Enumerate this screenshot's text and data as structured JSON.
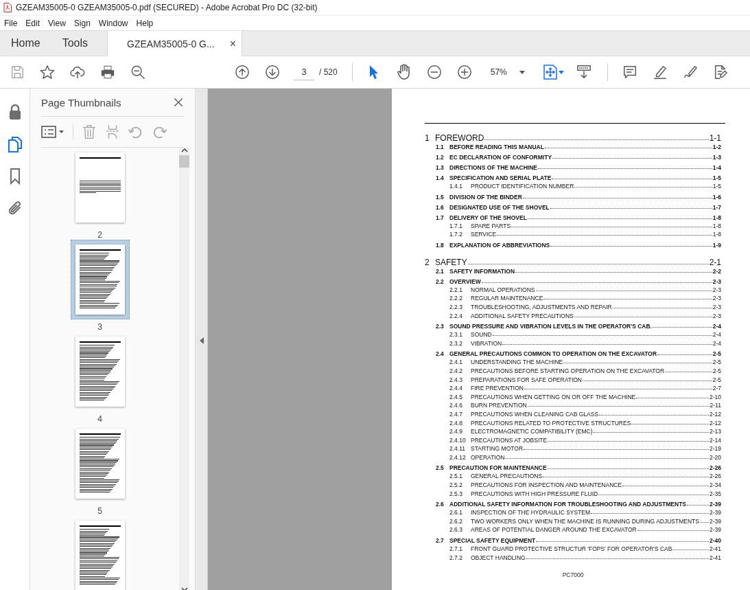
{
  "window": {
    "title": "GZEAM35005-0 GZEAM35005-0.pdf (SECURED) - Adobe Acrobat Pro DC (32-bit)"
  },
  "menu": [
    "File",
    "Edit",
    "View",
    "Sign",
    "Window",
    "Help"
  ],
  "tabs": [
    {
      "label": "Home",
      "selected": false,
      "kind": "nav"
    },
    {
      "label": "Tools",
      "selected": false,
      "kind": "nav"
    },
    {
      "label": "GZEAM35005-0 G...",
      "selected": true,
      "kind": "document",
      "close": "×"
    }
  ],
  "toolbar": {
    "page_field": {
      "value": "3"
    },
    "page_total": "/ 520",
    "zoom": "57%",
    "select_tools": [
      {
        "kind": "pointer",
        "selected": true
      },
      {
        "kind": "hand",
        "selected": false
      }
    ]
  },
  "rail": [
    {
      "kind": "lock",
      "selected": false
    },
    {
      "kind": "pages",
      "selected": true
    },
    {
      "kind": "bookmark",
      "selected": false
    },
    {
      "kind": "attachment",
      "selected": false
    }
  ],
  "sidebar": {
    "title": "Page Thumbnails",
    "thumbnails": [
      {
        "label": "2",
        "selected": false,
        "kind": "sparse"
      },
      {
        "label": "3",
        "selected": true,
        "kind": "toc"
      },
      {
        "label": "4",
        "selected": false,
        "kind": "toc"
      },
      {
        "label": "5",
        "selected": false,
        "kind": "toc"
      },
      {
        "selected": false,
        "kind": "toc"
      }
    ]
  },
  "document": {
    "footer": "PC7000",
    "chapters": [
      {
        "number": "1",
        "title": "FOREWORD",
        "page": "1-1",
        "sections": [
          {
            "number": "1.1",
            "title": "BEFORE READING THIS MANUAL",
            "page": "1-2"
          },
          {
            "number": "1.2",
            "title": "EC DECLARATION OF CONFORMITY",
            "page": "1-3"
          },
          {
            "number": "1.3",
            "title": "DIRECTIONS OF THE MACHINE",
            "page": "1-4"
          },
          {
            "number": "1.4",
            "title": "SPECIFICATION AND SERIAL PLATE",
            "page": "1-5",
            "children": [
              {
                "number": "1.4.1",
                "title": "PRODUCT IDENTIFICATION NUMBER",
                "page": "1-5"
              }
            ]
          },
          {
            "number": "1.5",
            "title": "DIVISION OF THE BINDER",
            "page": "1-6"
          },
          {
            "number": "1.6",
            "title": "DESIGNATED USE OF THE SHOVEL",
            "page": "1-7"
          },
          {
            "number": "1.7",
            "title": "DELIVERY OF THE SHOVEL",
            "page": "1-8",
            "children": [
              {
                "number": "1.7.1",
                "title": "SPARE PARTS",
                "page": "1-8"
              },
              {
                "number": "1.7.2",
                "title": "SERVICE",
                "page": "1-8"
              }
            ]
          },
          {
            "number": "1.8",
            "title": "EXPLANATION OF ABBREVIATIONS",
            "page": "1-9"
          }
        ]
      },
      {
        "number": "2",
        "title": "SAFETY",
        "page": "2-1",
        "sections": [
          {
            "number": "2.1",
            "title": "SAFETY INFORMATION",
            "page": "2-2"
          },
          {
            "number": "2.2",
            "title": "OVERVIEW",
            "page": "2-3",
            "children": [
              {
                "number": "2.2.1",
                "title": "NORMAL OPERATIONS",
                "page": "2-3"
              },
              {
                "number": "2.2.2",
                "title": "REGULAR MAINTENANCE",
                "page": "2-3"
              },
              {
                "number": "2.2.3",
                "title": "TROUBLESHOOTING, ADJUSTMENTS AND REPAIR",
                "page": "2-3"
              },
              {
                "number": "2.2.4",
                "title": "ADDITIONAL SAFETY PRECAUTIONS",
                "page": "2-3"
              }
            ]
          },
          {
            "number": "2.3",
            "title": "SOUND PRESSURE AND VIBRATION LEVELS IN THE OPERATOR'S CAB.",
            "page": "2-4",
            "children": [
              {
                "number": "2.3.1",
                "title": "SOUND",
                "page": "2-4"
              },
              {
                "number": "2.3.2",
                "title": "VIBRATION",
                "page": "2-4"
              }
            ]
          },
          {
            "number": "2.4",
            "title": "GENERAL PRECAUTIONS COMMON TO OPERATION ON THE EXCAVATOR",
            "page": "2-5",
            "children": [
              {
                "number": "2.4.1",
                "title": "UNDERSTANDING THE MACHINE",
                "page": "2-5"
              },
              {
                "number": "2.4.2",
                "title": "PRECAUTIONS BEFORE STARTING OPERATION ON THE EXCAVATOR",
                "page": "2-5"
              },
              {
                "number": "2.4.3",
                "title": "PREPARATIONS FOR SAFE OPERATION",
                "page": "2-5"
              },
              {
                "number": "2.4.4",
                "title": "FIRE PREVENTION",
                "page": "2-7"
              },
              {
                "number": "2.4.5",
                "title": "PRECAUTIONS WHEN GETTING ON OR OFF THE MACHINE",
                "page": "2-10"
              },
              {
                "number": "2.4.6",
                "title": "BURN PREVENTION",
                "page": "2-11"
              },
              {
                "number": "2.4.7",
                "title": "PRECAUTIONS WHEN CLEANING CAB GLASS",
                "page": "2-12"
              },
              {
                "number": "2.4.8",
                "title": "PRECAUTIONS RELATED TO PROTECTIVE STRUCTURES",
                "page": "2-12"
              },
              {
                "number": "2.4.9",
                "title": "ELECTROMAGNETIC COMPATIBILITY (EMC)",
                "page": "2-13"
              },
              {
                "number": "2.4.10",
                "title": "PRECAUTIONS AT JOBSITE",
                "page": "2-14"
              },
              {
                "number": "2.4.11",
                "title": "STARTING MOTOR",
                "page": "2-19"
              },
              {
                "number": "2.4.12",
                "title": "OPERATION",
                "page": "2-20"
              }
            ]
          },
          {
            "number": "2.5",
            "title": "PRECAUTION FOR MAINTENANCE",
            "page": "2-26",
            "children": [
              {
                "number": "2.5.1",
                "title": "GENERAL PRECAUTIONS",
                "page": "2-26"
              },
              {
                "number": "2.5.2",
                "title": "PRECAUTIONS FOR INSPECTION AND MAINTENANCE",
                "page": "2-34"
              },
              {
                "number": "2.5.3",
                "title": "PRECAUTIONS WITH HIGH PRESSURE FLUID",
                "page": "2-35"
              }
            ]
          },
          {
            "number": "2.6",
            "title": "ADDITIONAL SAFETY INFORMATION FOR TROUBLESHOOTING AND ADJUSTMENTS",
            "page": "2-39",
            "children": [
              {
                "number": "2.6.1",
                "title": "INSPECTION OF THE HYDRAULIC SYSTEM",
                "page": "2-39"
              },
              {
                "number": "2.6.2",
                "title": "TWO WORKERS ONLY WHEN THE MACHINE IS RUNNING DURING ADJUSTMENTS",
                "page": "2-39"
              },
              {
                "number": "2.6.3",
                "title": "AREAS OF POTENTIAL DANGER AROUND THE EXCAVATOR",
                "page": "2-39"
              }
            ]
          },
          {
            "number": "2.7",
            "title": "SPECIAL SAFETY EQUIPMENT",
            "page": "2-40",
            "children": [
              {
                "number": "2.7.1",
                "title": "FRONT GUARD PROTECTIVE STRUCTUR 'FOPS' FOR OPERATOR'S CAB",
                "page": "2-41"
              },
              {
                "number": "2.7.2",
                "title": "OBJECT HANDLING",
                "page": "2-41"
              }
            ]
          }
        ]
      }
    ]
  }
}
